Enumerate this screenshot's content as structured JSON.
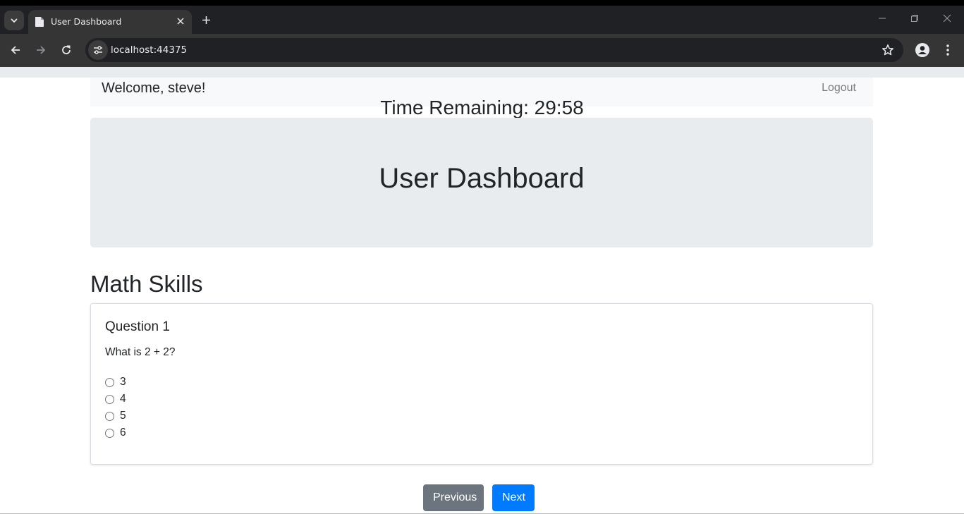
{
  "browser": {
    "tab_title": "User Dashboard",
    "url": "localhost:44375",
    "icons": {
      "tab_search": "chevron-down-icon",
      "favicon": "document-icon",
      "tab_close": "close-icon",
      "new_tab": "plus-icon",
      "minimize": "minimize-icon",
      "restore": "restore-icon",
      "close_window": "close-icon",
      "back": "arrow-left-icon",
      "forward": "arrow-right-icon",
      "reload": "reload-icon",
      "site_info": "tune-icon",
      "bookmark": "star-icon",
      "profile": "person-icon",
      "menu": "more-vert-icon"
    }
  },
  "navbar": {
    "welcome": "Welcome, steve!",
    "logout": "Logout"
  },
  "timer": "Time Remaining: 29:58",
  "jumbotron": {
    "title": "User Dashboard"
  },
  "section": {
    "title": "Math Skills"
  },
  "question": {
    "title": "Question 1",
    "text": "What is 2 + 2?",
    "options": [
      "3",
      "4",
      "5",
      "6"
    ]
  },
  "buttons": {
    "previous": "Previous",
    "next": "Next"
  },
  "colors": {
    "primary": "#007bff",
    "secondary": "#6c757d",
    "jumbotron_bg": "#e9ecef",
    "navbar_bg": "#f8f9fa"
  }
}
